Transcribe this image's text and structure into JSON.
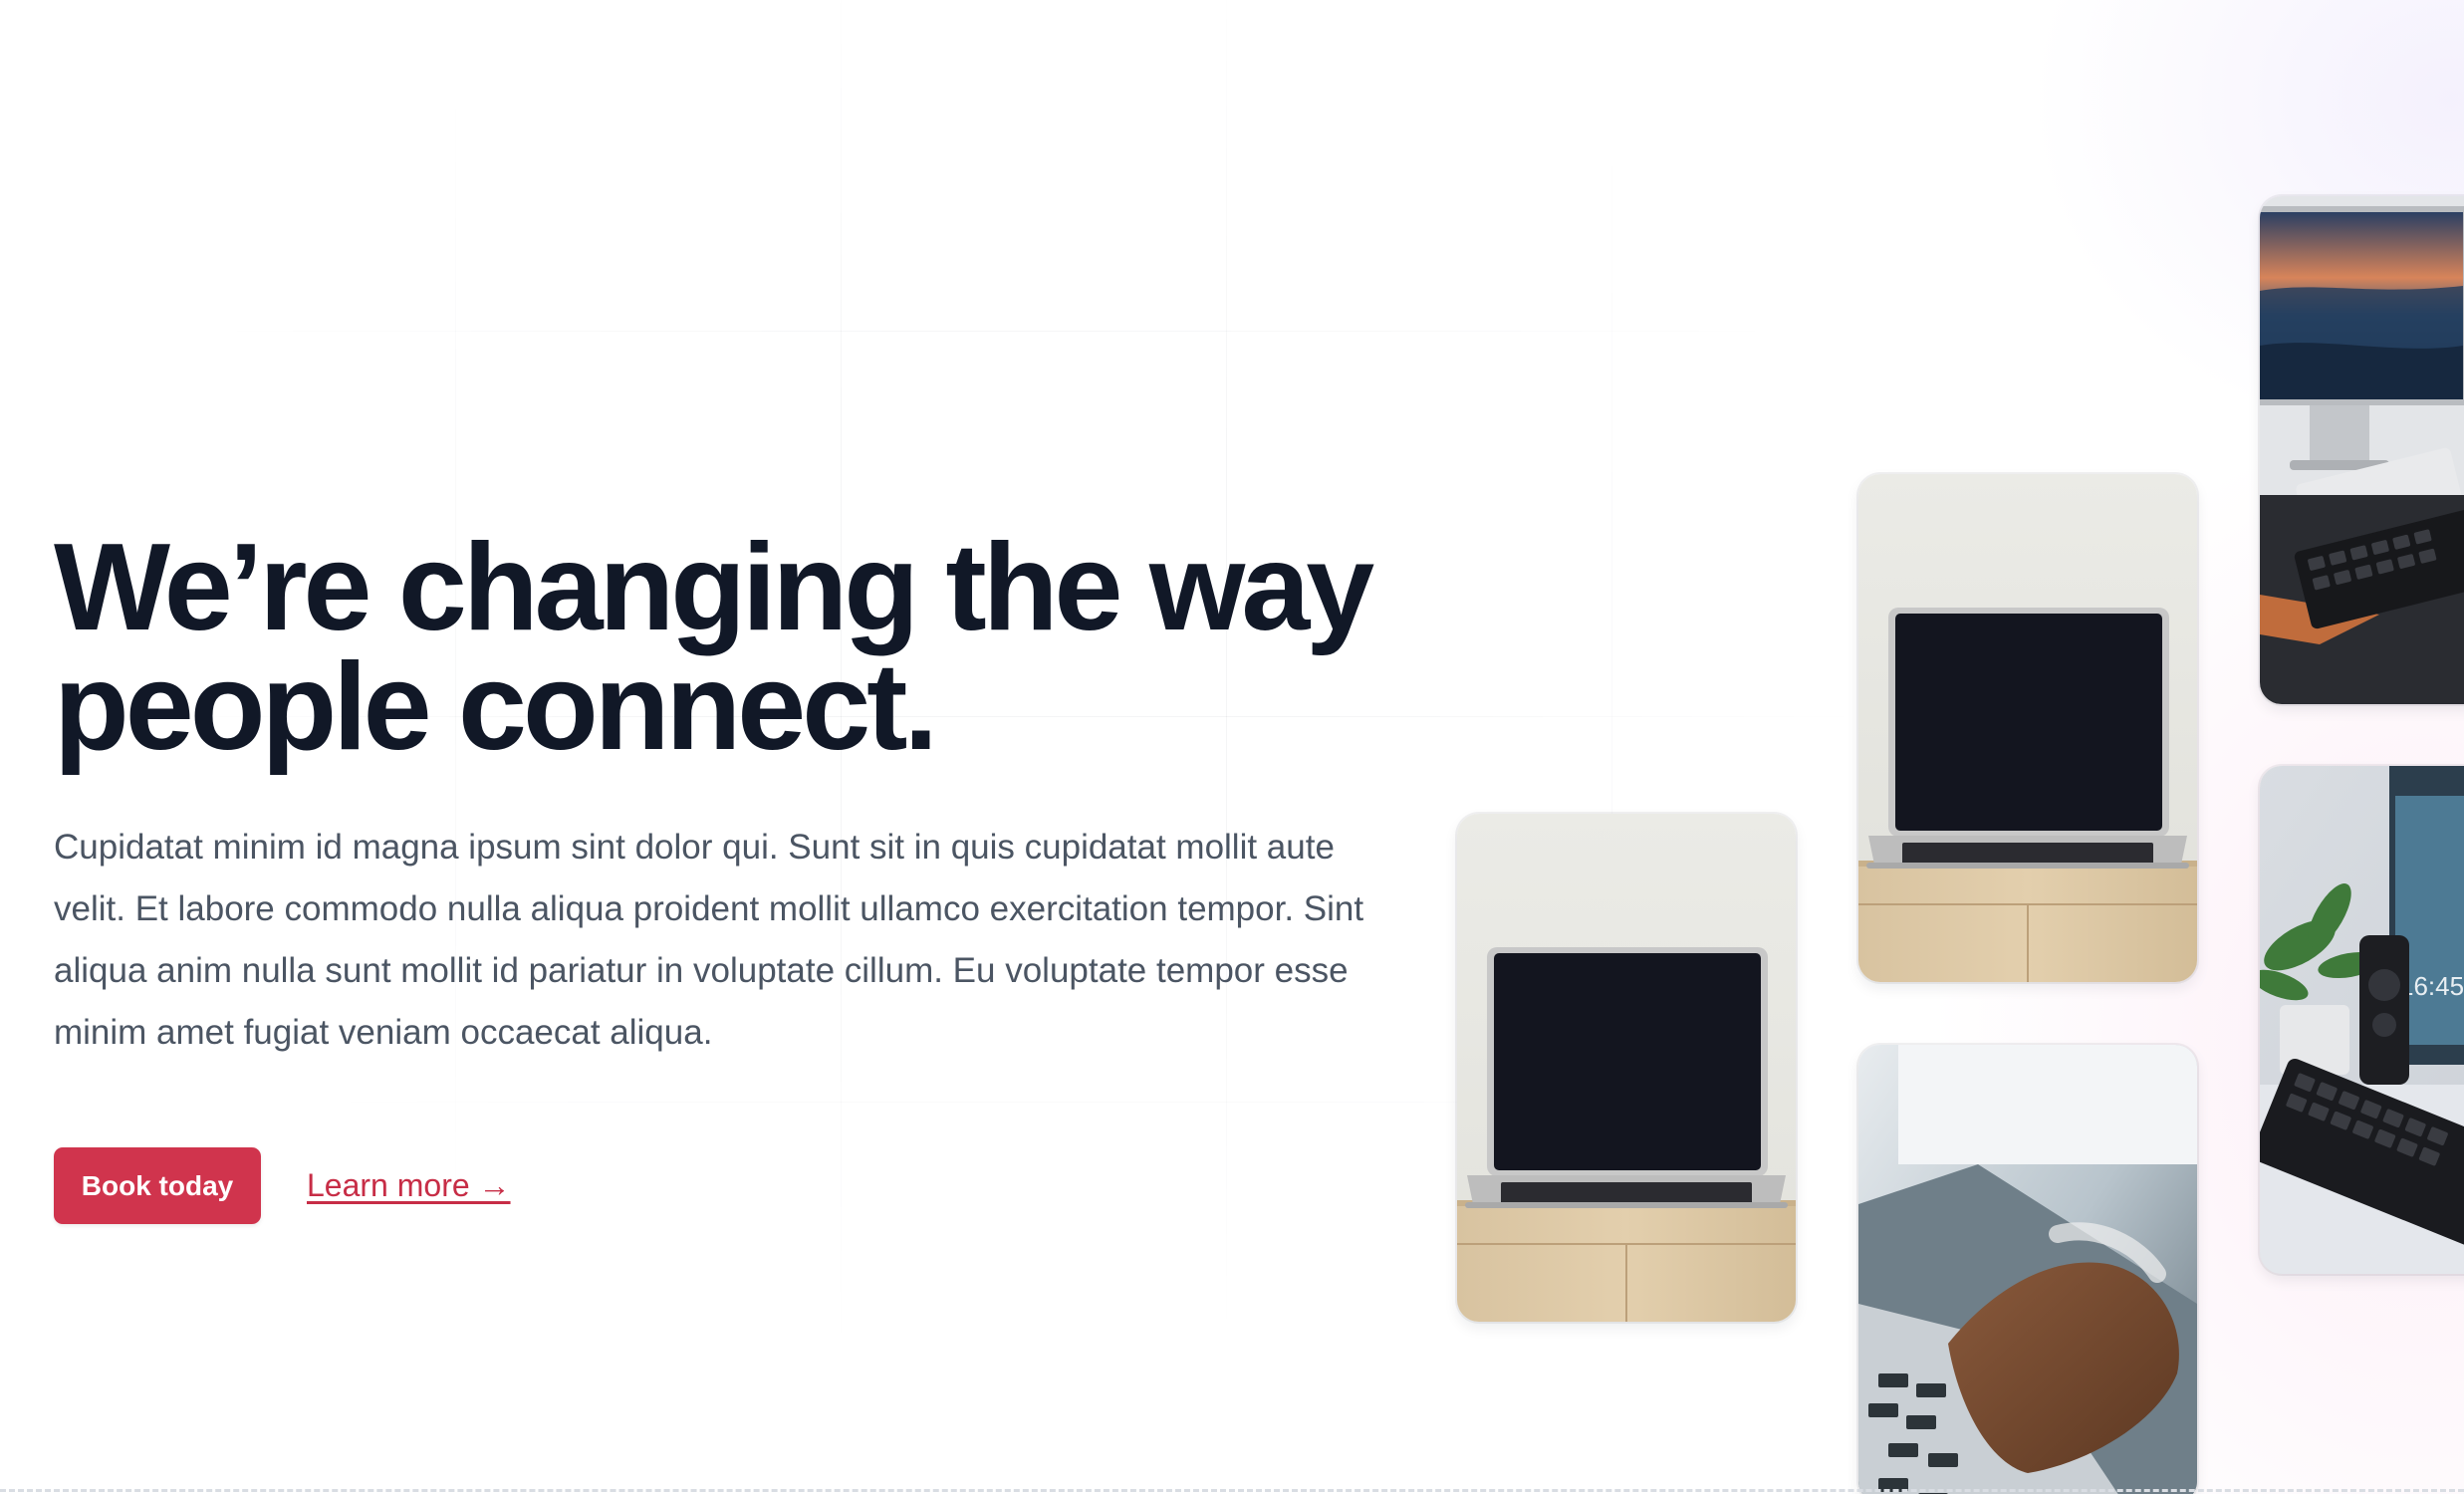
{
  "hero": {
    "headline_line1": "We’re changing the way",
    "headline_line2": "people connect.",
    "description": "Cupidatat minim id magna ipsum sint dolor qui. Sunt sit in quis cupidatat mollit aute velit. Et labore commodo nulla aliqua proident mollit ullamco exercitation tempor. Sint aliqua anim nulla sunt mollit id pariatur in voluptate cillum. Eu voluptate tempor esse minim amet fugiat veniam occaecat aliqua.",
    "primary_button": "Book today",
    "secondary_link": "Learn more →"
  },
  "gallery": {
    "images": [
      {
        "name": "laptop-on-desk-photo"
      },
      {
        "name": "laptop-on-desk-photo"
      },
      {
        "name": "hands-typing-laptop-photo"
      },
      {
        "name": "monitor-keyboard-desk-photo"
      },
      {
        "name": "desk-clock-plant-keyboard-photo"
      }
    ]
  },
  "clock_display": "16:45",
  "colors": {
    "accent": "#d0344d",
    "heading": "#111827",
    "body_text": "#4b5563"
  }
}
